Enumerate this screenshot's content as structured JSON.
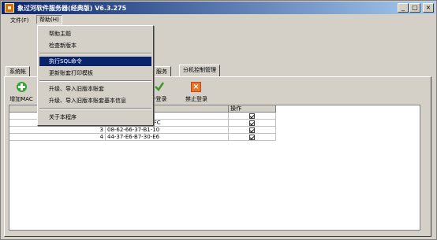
{
  "window": {
    "title": "象过河软件服务器(经典版) V6.3.275",
    "min_label": "_",
    "max_label": "□",
    "close_label": "×"
  },
  "menubar": {
    "file": "文件(F)",
    "help": "帮助(H)"
  },
  "help_menu": {
    "items": [
      "帮助主题",
      "检查新版本",
      "执行SQL命令",
      "更新账套打印模板",
      "升级、导入旧版本账套",
      "升级、导入旧版本账套基本信息",
      "关于本程序"
    ],
    "highlighted_index": 2
  },
  "tabs": {
    "system": "系统帐",
    "service": "服务",
    "branch_control": "分机控制管理"
  },
  "toolbar": {
    "add_label": "增加MAC",
    "allow_label": "许登录",
    "forbid_label": "禁止登录"
  },
  "table": {
    "headers": [
      "",
      "C地址",
      "操作"
    ],
    "rows": [
      {
        "index": "2",
        "mac": "FC-4D-D4-B7-5F-FC",
        "checked": true
      },
      {
        "index": "3",
        "mac": "08-62-66-37-B1-10",
        "checked": true
      },
      {
        "index": "4",
        "mac": "44-37-E6-B7-30-E6",
        "checked": true
      }
    ],
    "first_row_checked": true
  },
  "colors": {
    "titlebar_start": "#0a246a",
    "titlebar_end": "#a6caf0",
    "menu_highlight": "#0a246a",
    "face": "#d4d0c8"
  }
}
